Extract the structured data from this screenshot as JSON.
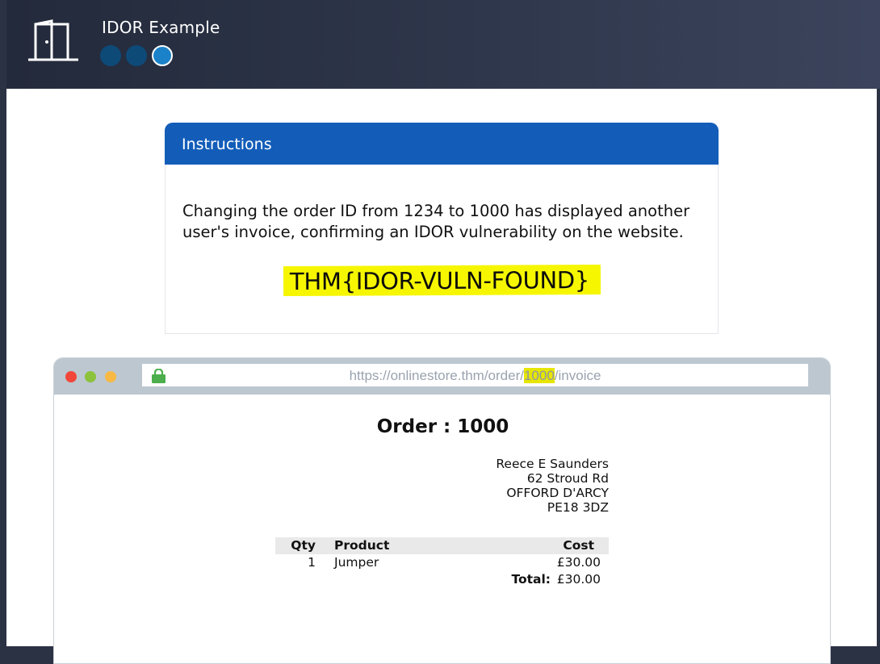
{
  "header": {
    "title": "IDOR Example",
    "icon": "door-icon",
    "steps": [
      {
        "state": "done"
      },
      {
        "state": "done"
      },
      {
        "state": "current"
      }
    ]
  },
  "instructions": {
    "heading": "Instructions",
    "body": "Changing the order ID from 1234 to 1000 has displayed another user's invoice, confirming an IDOR vulnerability on the website.",
    "flag": "THM{IDOR-VULN-FOUND}"
  },
  "browser": {
    "url_prefix": "https://onlinestore.thm/order/",
    "url_id": "1000",
    "url_suffix": "/invoice"
  },
  "invoice": {
    "title": "Order : 1000",
    "address": [
      "Reece E Saunders",
      "62 Stroud Rd",
      "OFFORD D'ARCY",
      "PE18 3DZ"
    ],
    "columns": {
      "qty": "Qty",
      "product": "Product",
      "cost": "Cost"
    },
    "items": [
      {
        "qty": "1",
        "product": "Jumper",
        "cost": "£30.00"
      }
    ],
    "total_label": "Total:",
    "total_value": "£30.00"
  },
  "colors": {
    "header_bg": "#2b3244",
    "card_header": "#135db9",
    "flag_highlight": "#f6f600",
    "step_done": "#0d4a78",
    "step_current": "#1b82c9"
  }
}
